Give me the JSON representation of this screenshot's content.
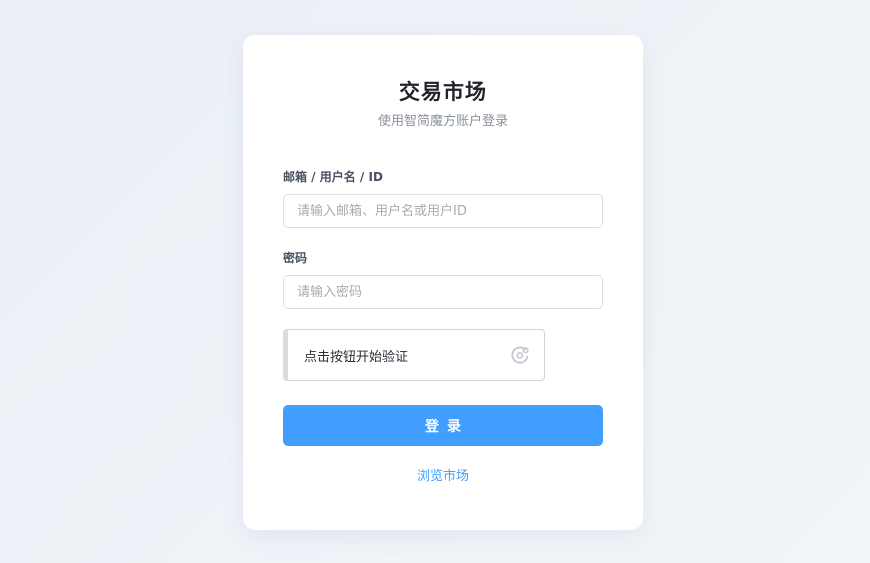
{
  "header": {
    "title": "交易市场",
    "subtitle": "使用智简魔方账户登录"
  },
  "form": {
    "account": {
      "label": "邮箱 / 用户名 / ID",
      "placeholder": "请输入邮箱、用户名或用户ID",
      "value": ""
    },
    "password": {
      "label": "密码",
      "placeholder": "请输入密码",
      "value": ""
    },
    "captcha": {
      "text": "点击按钮开始验证",
      "icon": "captcha-refresh-icon"
    },
    "submit_label": "登录"
  },
  "footer": {
    "browse_link": "浏览市场"
  },
  "colors": {
    "primary": "#409eff",
    "card_bg": "#ffffff",
    "page_bg": "#eef3f8"
  }
}
